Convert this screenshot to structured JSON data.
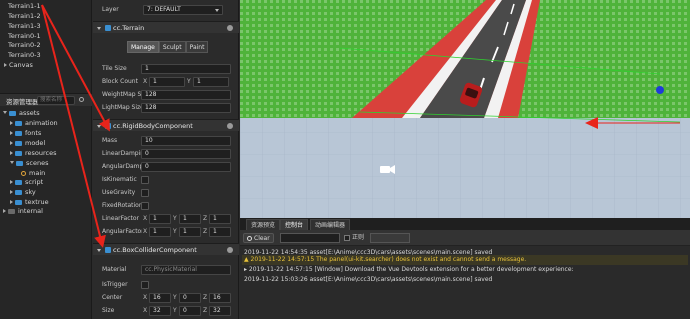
{
  "hierarchy": {
    "items": [
      "Terrain1-1",
      "Terrain1-2",
      "Terrain1-3",
      "Terrain0-1",
      "Terrain0-2",
      "Terrain0-3",
      "Canvas"
    ]
  },
  "assets": {
    "title": "资源管理器",
    "search_placeholder": "搜索名称",
    "items": [
      "assets",
      "animation",
      "fonts",
      "model",
      "resources",
      "scenes",
      "main",
      "script",
      "sky",
      "textrue",
      "internal"
    ]
  },
  "inspector": {
    "layer_label": "Layer",
    "layer_value": "7: DEFAULT",
    "terrain_title": "cc.Terrain",
    "terrain_tabs": [
      "Manage",
      "Sculpt",
      "Paint"
    ],
    "tile_size_label": "Tile Size",
    "tile_size": "1",
    "block_count_label": "Block Count",
    "block_count_x": "1",
    "block_count_y": "1",
    "weightmap_label": "WeightMap Siz",
    "weightmap_value": "128",
    "lightmap_label": "LightMap Size",
    "lightmap_value": "128",
    "rigidbody_title": "cc.RigidBodyComponent",
    "mass_label": "Mass",
    "mass_value": "10",
    "linear_damp_label": "LinearDamping",
    "linear_damp_value": "0",
    "angular_damp_label": "AngularDamping",
    "angular_damp_value": "0",
    "is_kinematic_label": "IsKinematic",
    "use_gravity_label": "UseGravity",
    "fixed_rotation_label": "FixedRotation",
    "linear_factor_label": "LinearFactor",
    "linear_factor": [
      "1",
      "1",
      "1"
    ],
    "angular_factor_label": "AngularFactor",
    "angular_factor": [
      "1",
      "1",
      "1"
    ],
    "boxcollider_title": "cc.BoxColliderComponent",
    "material_label": "Material",
    "material_value": "cc.PhysicMaterial",
    "is_trigger_label": "IsTrigger",
    "center_label": "Center",
    "center": [
      "16",
      "0",
      "16"
    ],
    "size_label": "Size",
    "size": [
      "32",
      "0",
      "32"
    ],
    "axes": [
      "X",
      "Y",
      "Z"
    ]
  },
  "panel_tabs": [
    "资源预览",
    "控制台",
    "动画编辑器"
  ],
  "console": {
    "clear_label": "Clear",
    "regex_label": "正则",
    "logs": [
      {
        "text": "2019-11-22 14:54:35 asset[E:\\Anime\\ccc3D\\cars\\assets\\scenes\\main.scene] saved",
        "color": "#d8d8d8"
      },
      {
        "text": "▲ 2019-11-22 14:57:15 The panel(ui-kit.searcher) does not exist and cannot send a message.",
        "color": "#e8c23a"
      },
      {
        "text": "▸ 2019-11-22 14:57:15 [Window] Download the Vue Devtools extension for a better development experience:",
        "color": "#d8d8d8"
      },
      {
        "text": "2019-11-22 15:03:26 asset[E:\\Anime\\ccc3D\\cars\\assets\\scenes\\main.scene] saved",
        "color": "#d8d8d8"
      }
    ]
  },
  "colors": {
    "accent": "#3a8fd1",
    "annotation": "#e8241b",
    "grass": "#4fb33a",
    "road": "#4a4a4a",
    "track_red": "#d9413b"
  }
}
